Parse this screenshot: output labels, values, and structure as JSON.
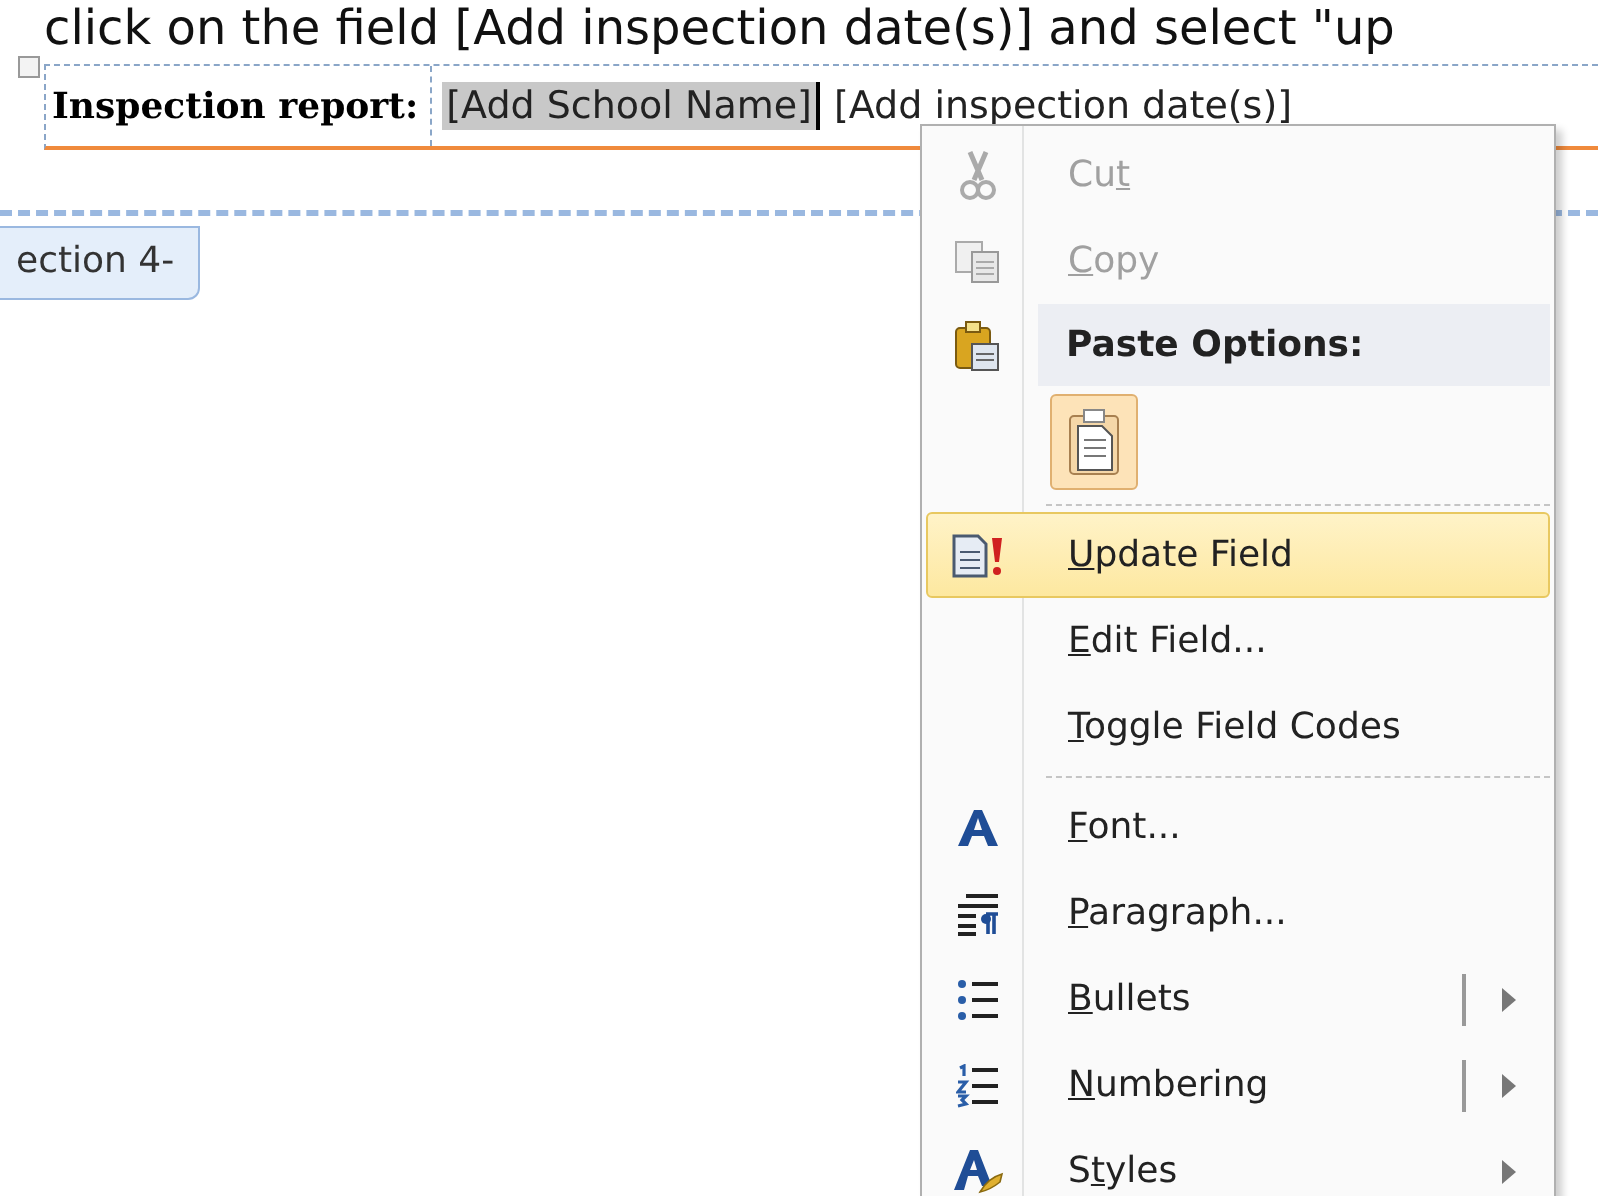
{
  "instruction": "click on the field [Add inspection date(s)]  and select \"up",
  "header": {
    "label": "Inspection report:",
    "fields": [
      {
        "text": "[Add School Name]",
        "selected": true
      },
      {
        "text": "[Add inspection date(s)]",
        "selected": false
      }
    ]
  },
  "section_tab": "ection 4-",
  "menu": {
    "items": [
      {
        "kind": "command",
        "parts": [
          {
            "text": "Cu",
            "key": false
          },
          {
            "text": "t",
            "key": true
          }
        ],
        "disabled": true,
        "selected": false
      },
      {
        "kind": "command",
        "parts": [
          {
            "text": "C",
            "key": true
          },
          {
            "text": "opy",
            "key": false
          }
        ],
        "disabled": true,
        "selected": false
      },
      {
        "kind": "header",
        "text": "Paste Options:"
      },
      {
        "kind": "paste_options"
      },
      {
        "kind": "separator"
      },
      {
        "kind": "command",
        "parts": [
          {
            "text": "U",
            "key": true
          },
          {
            "text": "pdate Field",
            "key": false
          }
        ],
        "disabled": false,
        "selected": true
      },
      {
        "kind": "command",
        "parts": [
          {
            "text": "E",
            "key": true
          },
          {
            "text": "dit Field...",
            "key": false
          }
        ],
        "disabled": false,
        "selected": false
      },
      {
        "kind": "command",
        "parts": [
          {
            "text": "T",
            "key": true
          },
          {
            "text": "oggle Field Codes",
            "key": false
          }
        ],
        "disabled": false,
        "selected": false
      },
      {
        "kind": "separator"
      },
      {
        "kind": "command",
        "parts": [
          {
            "text": "F",
            "key": true
          },
          {
            "text": "ont...",
            "key": false
          }
        ],
        "disabled": false,
        "selected": false
      },
      {
        "kind": "command",
        "parts": [
          {
            "text": "P",
            "key": true
          },
          {
            "text": "aragraph...",
            "key": false
          }
        ],
        "disabled": false,
        "selected": false
      },
      {
        "kind": "command",
        "parts": [
          {
            "text": "B",
            "key": true
          },
          {
            "text": "ullets",
            "key": false
          }
        ],
        "disabled": false,
        "selected": false,
        "submenu": true,
        "split": true
      },
      {
        "kind": "command",
        "parts": [
          {
            "text": "N",
            "key": true
          },
          {
            "text": "umbering",
            "key": false
          }
        ],
        "disabled": false,
        "selected": false,
        "submenu": true,
        "split": true
      },
      {
        "kind": "command",
        "parts": [
          {
            "text": "S",
            "key": false
          },
          {
            "text": "t",
            "key": true
          },
          {
            "text": "yles",
            "key": false
          }
        ],
        "disabled": false,
        "selected": false,
        "submenu": true,
        "split": false
      }
    ]
  }
}
